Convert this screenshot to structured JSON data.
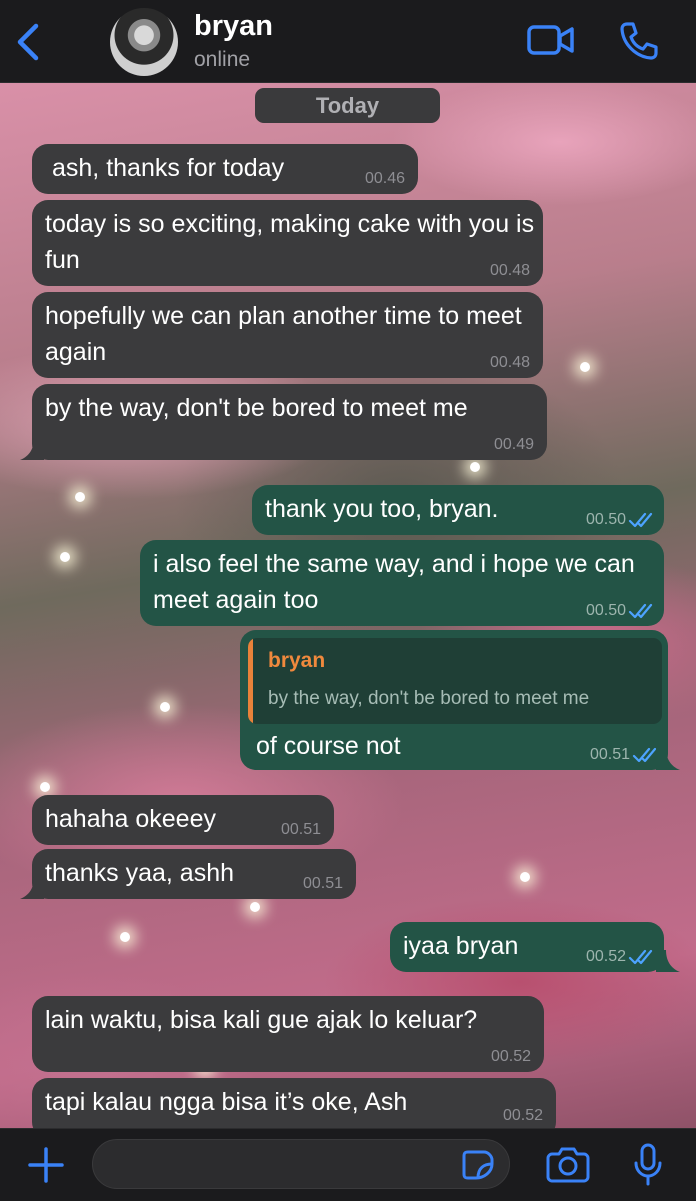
{
  "header": {
    "contact_name": "bryan",
    "status": "online"
  },
  "chat": {
    "date_separator": "Today",
    "messages": [
      {
        "direction": "incoming",
        "text": "ash, thanks for today",
        "time": "00.46"
      },
      {
        "direction": "incoming",
        "text": "today is so exciting, making cake with you is fun",
        "time": "00.48"
      },
      {
        "direction": "incoming",
        "text": "hopefully we can plan another time to meet again",
        "time": "00.48"
      },
      {
        "direction": "incoming",
        "text": "by the way, don't be bored to meet me",
        "time": "00.49"
      },
      {
        "direction": "outgoing",
        "text": "thank you too, bryan.",
        "time": "00.50",
        "read": true
      },
      {
        "direction": "outgoing",
        "text": "i also feel the same way, and i hope we can meet again too",
        "time": "00.50",
        "read": true
      },
      {
        "direction": "outgoing",
        "text": "of course not",
        "time": "00.51",
        "read": true,
        "reply_to": {
          "author": "bryan",
          "text": "by the way, don't be bored to meet me"
        }
      },
      {
        "direction": "incoming",
        "text": "hahaha okeeey",
        "time": "00.51"
      },
      {
        "direction": "incoming",
        "text": "thanks yaa, ashh",
        "time": "00.51"
      },
      {
        "direction": "outgoing",
        "text": "iyaa bryan",
        "time": "00.52",
        "read": true
      },
      {
        "direction": "incoming",
        "text": "lain waktu, bisa kali gue ajak lo keluar?",
        "time": "00.52"
      },
      {
        "direction": "incoming",
        "text": "tapi kalau ngga bisa it’s oke, Ash",
        "time": "00.52"
      }
    ]
  },
  "input": {
    "placeholder": ""
  },
  "colors": {
    "accent": "#3a82f7",
    "incoming_bubble": "#3b3b3d",
    "outgoing_bubble": "#235446",
    "reply_author": "#f0893d",
    "read_tick": "#4da3ff"
  },
  "icons": {
    "back": "chevron-left-icon",
    "video": "video-camera-icon",
    "call": "phone-icon",
    "plus": "plus-icon",
    "sticker": "sticker-icon",
    "camera": "camera-icon",
    "mic": "microphone-icon",
    "read": "double-check-icon"
  }
}
